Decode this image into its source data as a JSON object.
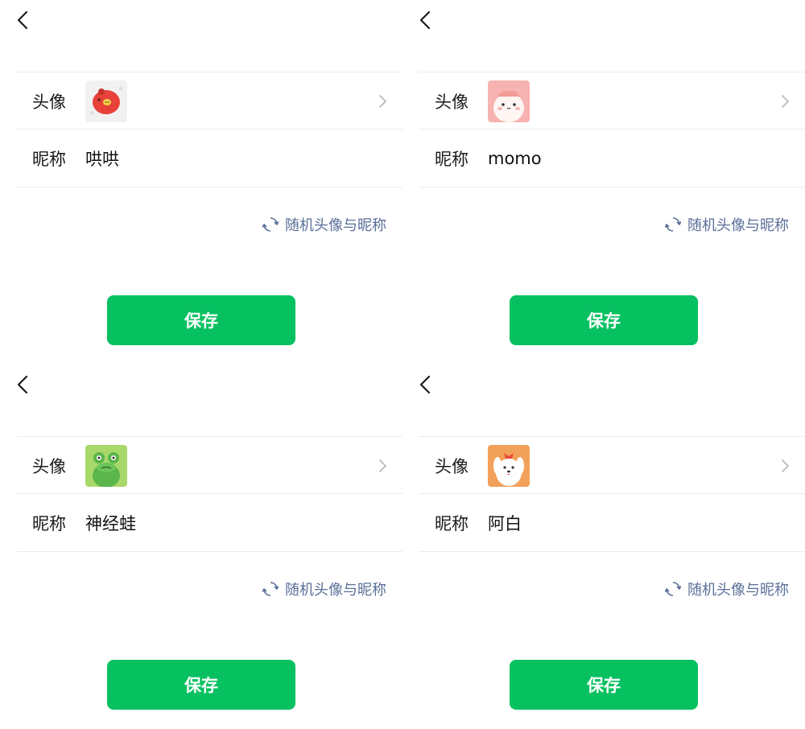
{
  "labels": {
    "avatar": "头像",
    "nickname": "昵称",
    "random": "随机头像与昵称",
    "save": "保存"
  },
  "colors": {
    "primary_green": "#07c160",
    "link_blue": "#5a6f99",
    "divider": "#ececec"
  },
  "icons": {
    "back": "back-arrow-icon",
    "chevron": "chevron-right-icon",
    "refresh": "refresh-icon"
  },
  "panels": [
    {
      "nickname": "哄哄",
      "avatar": "red-pig-avatar"
    },
    {
      "nickname": "momo",
      "avatar": "pink-creature-avatar"
    },
    {
      "nickname": "神经蛙",
      "avatar": "green-frog-avatar"
    },
    {
      "nickname": "阿白",
      "avatar": "white-dog-avatar"
    }
  ]
}
